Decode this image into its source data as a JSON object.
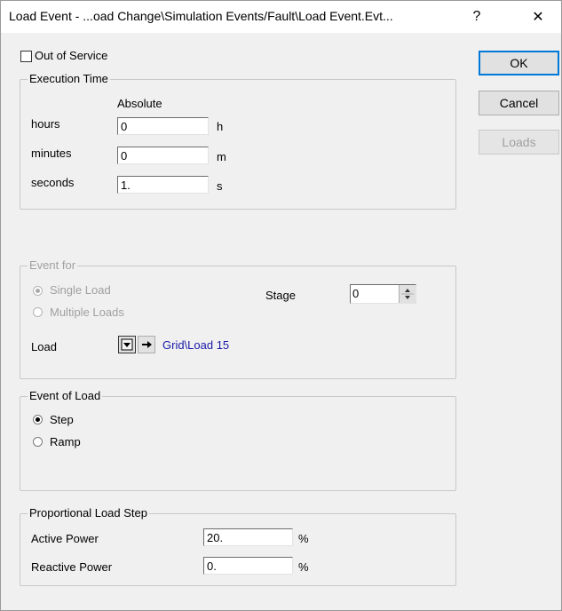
{
  "window": {
    "title": "Load Event - ...oad Change\\Simulation Events/Fault\\Load Event.Evt...",
    "help_label": "?",
    "close_label": "✕"
  },
  "out_of_service": {
    "label": "Out of Service",
    "checked": false
  },
  "buttons": {
    "ok": "OK",
    "cancel": "Cancel",
    "loads": "Loads"
  },
  "execution_time": {
    "title": "Execution Time",
    "column_header": "Absolute",
    "rows": [
      {
        "label": "hours",
        "value": "0",
        "unit": "h"
      },
      {
        "label": "minutes",
        "value": "0",
        "unit": "m"
      },
      {
        "label": "seconds",
        "value": "1.",
        "unit": "s"
      }
    ]
  },
  "event_for": {
    "title": "Event for",
    "options": [
      {
        "label": "Single Load",
        "selected": true
      },
      {
        "label": "Multiple Loads",
        "selected": false
      }
    ],
    "stage_label": "Stage",
    "stage_value": "0",
    "load_label": "Load",
    "load_link": "Grid\\Load 15"
  },
  "event_of_load": {
    "title": "Event of Load",
    "options": [
      {
        "label": "Step",
        "selected": true
      },
      {
        "label": "Ramp",
        "selected": false
      }
    ]
  },
  "proportional_load_step": {
    "title": "Proportional Load Step",
    "rows": [
      {
        "label": "Active Power",
        "value": "20.",
        "unit": "%"
      },
      {
        "label": "Reactive Power",
        "value": "0.",
        "unit": "%"
      }
    ]
  }
}
